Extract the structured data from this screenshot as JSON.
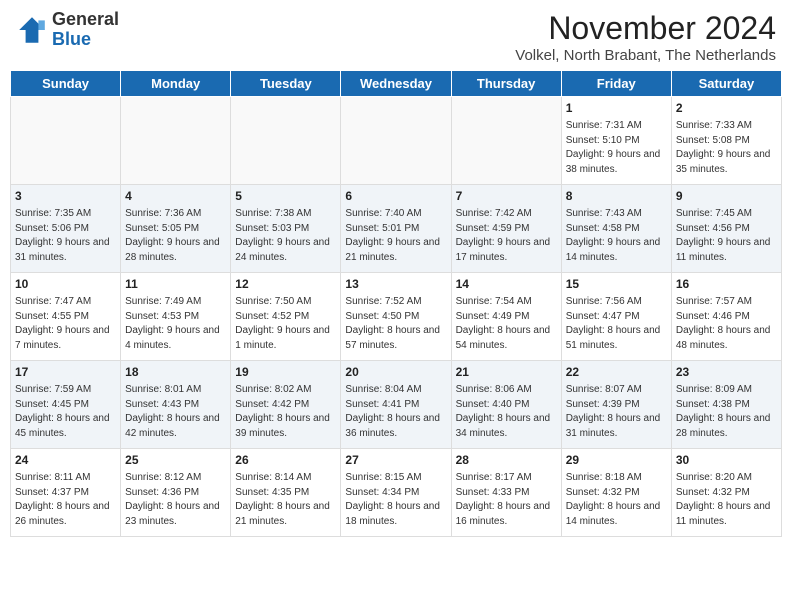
{
  "header": {
    "logo_general": "General",
    "logo_blue": "Blue",
    "month_title": "November 2024",
    "location": "Volkel, North Brabant, The Netherlands"
  },
  "days_of_week": [
    "Sunday",
    "Monday",
    "Tuesday",
    "Wednesday",
    "Thursday",
    "Friday",
    "Saturday"
  ],
  "weeks": [
    [
      {
        "day": "",
        "info": ""
      },
      {
        "day": "",
        "info": ""
      },
      {
        "day": "",
        "info": ""
      },
      {
        "day": "",
        "info": ""
      },
      {
        "day": "",
        "info": ""
      },
      {
        "day": "1",
        "info": "Sunrise: 7:31 AM\nSunset: 5:10 PM\nDaylight: 9 hours and 38 minutes."
      },
      {
        "day": "2",
        "info": "Sunrise: 7:33 AM\nSunset: 5:08 PM\nDaylight: 9 hours and 35 minutes."
      }
    ],
    [
      {
        "day": "3",
        "info": "Sunrise: 7:35 AM\nSunset: 5:06 PM\nDaylight: 9 hours and 31 minutes."
      },
      {
        "day": "4",
        "info": "Sunrise: 7:36 AM\nSunset: 5:05 PM\nDaylight: 9 hours and 28 minutes."
      },
      {
        "day": "5",
        "info": "Sunrise: 7:38 AM\nSunset: 5:03 PM\nDaylight: 9 hours and 24 minutes."
      },
      {
        "day": "6",
        "info": "Sunrise: 7:40 AM\nSunset: 5:01 PM\nDaylight: 9 hours and 21 minutes."
      },
      {
        "day": "7",
        "info": "Sunrise: 7:42 AM\nSunset: 4:59 PM\nDaylight: 9 hours and 17 minutes."
      },
      {
        "day": "8",
        "info": "Sunrise: 7:43 AM\nSunset: 4:58 PM\nDaylight: 9 hours and 14 minutes."
      },
      {
        "day": "9",
        "info": "Sunrise: 7:45 AM\nSunset: 4:56 PM\nDaylight: 9 hours and 11 minutes."
      }
    ],
    [
      {
        "day": "10",
        "info": "Sunrise: 7:47 AM\nSunset: 4:55 PM\nDaylight: 9 hours and 7 minutes."
      },
      {
        "day": "11",
        "info": "Sunrise: 7:49 AM\nSunset: 4:53 PM\nDaylight: 9 hours and 4 minutes."
      },
      {
        "day": "12",
        "info": "Sunrise: 7:50 AM\nSunset: 4:52 PM\nDaylight: 9 hours and 1 minute."
      },
      {
        "day": "13",
        "info": "Sunrise: 7:52 AM\nSunset: 4:50 PM\nDaylight: 8 hours and 57 minutes."
      },
      {
        "day": "14",
        "info": "Sunrise: 7:54 AM\nSunset: 4:49 PM\nDaylight: 8 hours and 54 minutes."
      },
      {
        "day": "15",
        "info": "Sunrise: 7:56 AM\nSunset: 4:47 PM\nDaylight: 8 hours and 51 minutes."
      },
      {
        "day": "16",
        "info": "Sunrise: 7:57 AM\nSunset: 4:46 PM\nDaylight: 8 hours and 48 minutes."
      }
    ],
    [
      {
        "day": "17",
        "info": "Sunrise: 7:59 AM\nSunset: 4:45 PM\nDaylight: 8 hours and 45 minutes."
      },
      {
        "day": "18",
        "info": "Sunrise: 8:01 AM\nSunset: 4:43 PM\nDaylight: 8 hours and 42 minutes."
      },
      {
        "day": "19",
        "info": "Sunrise: 8:02 AM\nSunset: 4:42 PM\nDaylight: 8 hours and 39 minutes."
      },
      {
        "day": "20",
        "info": "Sunrise: 8:04 AM\nSunset: 4:41 PM\nDaylight: 8 hours and 36 minutes."
      },
      {
        "day": "21",
        "info": "Sunrise: 8:06 AM\nSunset: 4:40 PM\nDaylight: 8 hours and 34 minutes."
      },
      {
        "day": "22",
        "info": "Sunrise: 8:07 AM\nSunset: 4:39 PM\nDaylight: 8 hours and 31 minutes."
      },
      {
        "day": "23",
        "info": "Sunrise: 8:09 AM\nSunset: 4:38 PM\nDaylight: 8 hours and 28 minutes."
      }
    ],
    [
      {
        "day": "24",
        "info": "Sunrise: 8:11 AM\nSunset: 4:37 PM\nDaylight: 8 hours and 26 minutes."
      },
      {
        "day": "25",
        "info": "Sunrise: 8:12 AM\nSunset: 4:36 PM\nDaylight: 8 hours and 23 minutes."
      },
      {
        "day": "26",
        "info": "Sunrise: 8:14 AM\nSunset: 4:35 PM\nDaylight: 8 hours and 21 minutes."
      },
      {
        "day": "27",
        "info": "Sunrise: 8:15 AM\nSunset: 4:34 PM\nDaylight: 8 hours and 18 minutes."
      },
      {
        "day": "28",
        "info": "Sunrise: 8:17 AM\nSunset: 4:33 PM\nDaylight: 8 hours and 16 minutes."
      },
      {
        "day": "29",
        "info": "Sunrise: 8:18 AM\nSunset: 4:32 PM\nDaylight: 8 hours and 14 minutes."
      },
      {
        "day": "30",
        "info": "Sunrise: 8:20 AM\nSunset: 4:32 PM\nDaylight: 8 hours and 11 minutes."
      }
    ]
  ]
}
